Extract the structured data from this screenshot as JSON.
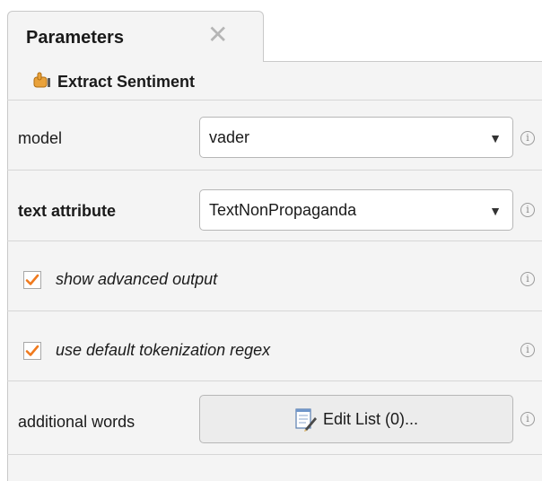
{
  "tab": {
    "title": "Parameters",
    "close_glyph": "✕"
  },
  "operator": {
    "name": "Extract Sentiment",
    "icon": "hand-pointer-icon"
  },
  "params": {
    "model": {
      "label": "model",
      "value": "vader"
    },
    "text_attribute": {
      "label": "text attribute",
      "value": "TextNonPropaganda"
    },
    "show_advanced_output": {
      "label": "show advanced output",
      "checked": true
    },
    "use_default_tokenization": {
      "label": "use default tokenization regex",
      "checked": true
    },
    "additional_words": {
      "label": "additional words",
      "button_label": "Edit List (0)..."
    }
  },
  "info_glyph": "i",
  "dropdown_arrow": "▼",
  "colors": {
    "check": "#f07a1e",
    "panel": "#f4f4f4",
    "border": "#c9c9c9"
  }
}
